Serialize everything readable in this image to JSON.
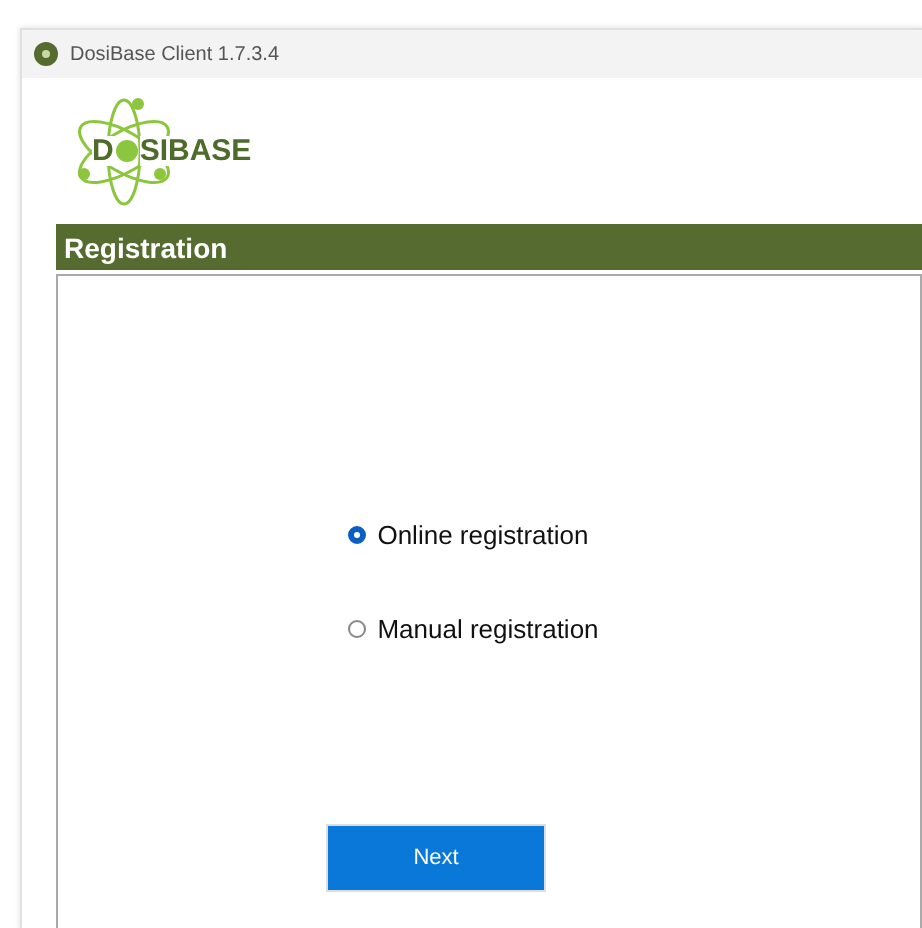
{
  "window": {
    "title": "DosiBase Client 1.7.3.4"
  },
  "logo": {
    "parts": [
      "D",
      "SIBASE"
    ]
  },
  "section": {
    "title": "Registration"
  },
  "options": [
    {
      "label": "Online registration",
      "selected": true
    },
    {
      "label": "Manual registration",
      "selected": false
    }
  ],
  "buttons": [
    {
      "label": "Next"
    }
  ]
}
